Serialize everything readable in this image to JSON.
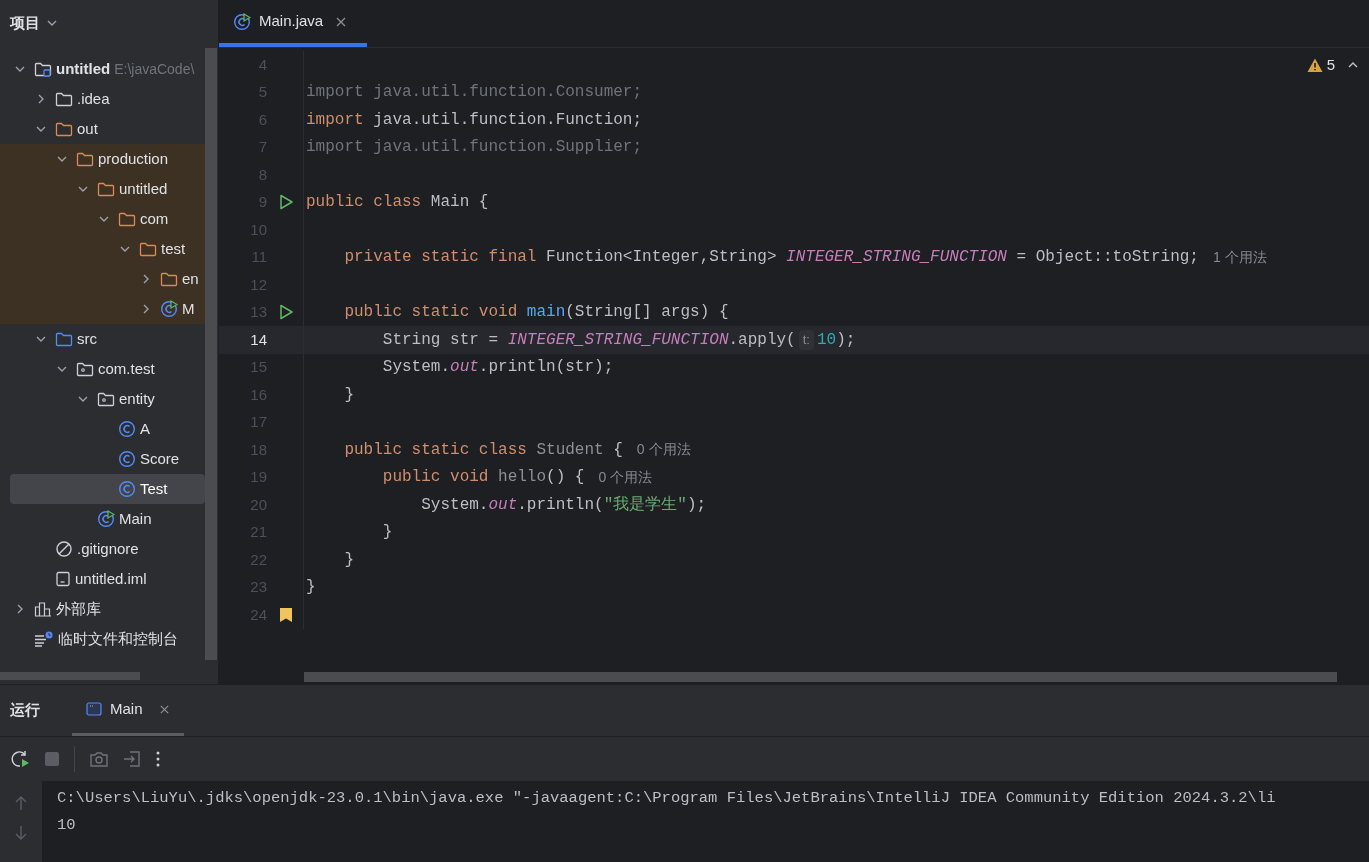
{
  "sidebar": {
    "title": "项目",
    "tree": [
      {
        "label": "untitled",
        "path": "E:\\javaCode\\",
        "kind": "module",
        "expanded": true,
        "selected": false,
        "children": [
          {
            "label": ".idea",
            "kind": "folder",
            "expanded": false,
            "selected": false
          },
          {
            "label": "out",
            "kind": "folder_excluded",
            "expanded": true,
            "selected": false,
            "children": [
              {
                "label": "production",
                "kind": "folder_excluded",
                "expanded": true,
                "selected": false,
                "children": [
                  {
                    "label": "untitled",
                    "kind": "folder_excluded",
                    "expanded": true,
                    "selected": false,
                    "children": [
                      {
                        "label": "com",
                        "kind": "folder_excluded",
                        "expanded": true,
                        "selected": false,
                        "children": [
                          {
                            "label": "test",
                            "kind": "folder_excluded",
                            "expanded": true,
                            "selected": false,
                            "children": [
                              {
                                "label": "en",
                                "kind": "folder_excluded",
                                "expanded": false,
                                "selected": false
                              },
                              {
                                "label": "M",
                                "kind": "class_main",
                                "expanded": false,
                                "selected": false
                              }
                            ]
                          }
                        ]
                      }
                    ]
                  }
                ]
              }
            ]
          },
          {
            "label": "src",
            "kind": "folder_source",
            "expanded": true,
            "selected": false,
            "children": [
              {
                "label": "com.test",
                "kind": "package",
                "expanded": true,
                "selected": false,
                "children": [
                  {
                    "label": "entity",
                    "kind": "package",
                    "expanded": true,
                    "selected": false,
                    "children": [
                      {
                        "label": "A",
                        "kind": "class",
                        "selected": false
                      },
                      {
                        "label": "Score",
                        "kind": "class",
                        "selected": false
                      },
                      {
                        "label": "Test",
                        "kind": "class",
                        "selected": true
                      }
                    ]
                  },
                  {
                    "label": "Main",
                    "kind": "class_main",
                    "selected": false
                  }
                ]
              }
            ]
          },
          {
            "label": ".gitignore",
            "kind": "ignore",
            "selected": false
          },
          {
            "label": "untitled.iml",
            "kind": "iml",
            "selected": false
          }
        ]
      },
      {
        "label": "外部库",
        "kind": "libraries",
        "expanded": false,
        "selected": false
      },
      {
        "label": "临时文件和控制台",
        "kind": "scratches",
        "selected": false
      }
    ]
  },
  "editor": {
    "tabs": [
      {
        "label": "Main.java",
        "selected": true
      }
    ],
    "warnings": "5",
    "lines": [
      {
        "number": "4",
        "current": false,
        "kind": "plain"
      },
      {
        "number": "5",
        "current": false,
        "kind": "plain",
        "segments": [
          {
            "kind": "code",
            "tokens": [
              {
                "kind": "unused",
                "text": "import java.util.function.Consumer;"
              }
            ]
          }
        ]
      },
      {
        "number": "6",
        "current": false,
        "kind": "plain",
        "segments": [
          {
            "kind": "code",
            "tokens": [
              {
                "kind": "keyword",
                "text": "import "
              },
              {
                "kind": "plain",
                "text": "java.util.function.Function;"
              }
            ]
          }
        ]
      },
      {
        "number": "7",
        "current": false,
        "kind": "plain",
        "segments": [
          {
            "kind": "code",
            "tokens": [
              {
                "kind": "unused",
                "text": "import java.util.function.Supplier;"
              }
            ]
          }
        ]
      },
      {
        "number": "8",
        "current": false,
        "kind": "plain"
      },
      {
        "number": "9",
        "current": false,
        "kind": "runnable",
        "segments": [
          {
            "kind": "code",
            "tokens": [
              {
                "kind": "keyword",
                "text": "public class "
              },
              {
                "kind": "plain",
                "text": "Main {"
              }
            ]
          }
        ]
      },
      {
        "number": "10",
        "current": false,
        "kind": "plain"
      },
      {
        "number": "11",
        "current": false,
        "kind": "plain",
        "segments": [
          {
            "kind": "code",
            "tokens": [
              {
                "kind": "keyword",
                "text": "    private static final "
              },
              {
                "kind": "plain",
                "text": "Function<Integer,String> "
              },
              {
                "kind": "field",
                "text": "INTEGER_STRING_FUNCTION"
              },
              {
                "kind": "plain",
                "text": " = Object::toString;"
              }
            ]
          },
          {
            "kind": "hint",
            "text": "1 个用法"
          }
        ]
      },
      {
        "number": "12",
        "current": false,
        "kind": "plain"
      },
      {
        "number": "13",
        "current": false,
        "kind": "runnable",
        "segments": [
          {
            "kind": "code",
            "tokens": [
              {
                "kind": "keyword",
                "text": "    public static void "
              },
              {
                "kind": "method",
                "text": "main"
              },
              {
                "kind": "plain",
                "text": "(String[] args) {"
              }
            ]
          }
        ]
      },
      {
        "number": "14",
        "current": true,
        "kind": "plain",
        "segments": [
          {
            "kind": "code",
            "tokens": [
              {
                "kind": "plain",
                "text": "        String str = "
              },
              {
                "kind": "field",
                "text": "INTEGER_STRING_FUNCTION"
              },
              {
                "kind": "plain",
                "text": ".apply("
              }
            ]
          },
          {
            "kind": "param",
            "text": "t:"
          },
          {
            "kind": "code",
            "tokens": [
              {
                "kind": "number",
                "text": "10"
              },
              {
                "kind": "plain",
                "text": ");"
              }
            ]
          }
        ]
      },
      {
        "number": "15",
        "current": false,
        "kind": "plain",
        "segments": [
          {
            "kind": "code",
            "tokens": [
              {
                "kind": "plain",
                "text": "        System."
              },
              {
                "kind": "field",
                "text": "out"
              },
              {
                "kind": "plain",
                "text": ".println(str);"
              }
            ]
          }
        ]
      },
      {
        "number": "16",
        "current": false,
        "kind": "plain",
        "segments": [
          {
            "kind": "code",
            "tokens": [
              {
                "kind": "plain",
                "text": "    }"
              }
            ]
          }
        ]
      },
      {
        "number": "17",
        "current": false,
        "kind": "plain"
      },
      {
        "number": "18",
        "current": false,
        "kind": "plain",
        "segments": [
          {
            "kind": "code",
            "tokens": [
              {
                "kind": "keyword",
                "text": "    public static class "
              },
              {
                "kind": "unused_decl",
                "text": "Student"
              },
              {
                "kind": "plain",
                "text": " {"
              }
            ]
          },
          {
            "kind": "hint",
            "text": "0 个用法"
          }
        ]
      },
      {
        "number": "19",
        "current": false,
        "kind": "plain",
        "segments": [
          {
            "kind": "code",
            "tokens": [
              {
                "kind": "keyword",
                "text": "        public void "
              },
              {
                "kind": "unused_decl",
                "text": "hello"
              },
              {
                "kind": "plain",
                "text": "() {"
              }
            ]
          },
          {
            "kind": "hint",
            "text": "0 个用法"
          }
        ]
      },
      {
        "number": "20",
        "current": false,
        "kind": "plain",
        "segments": [
          {
            "kind": "code",
            "tokens": [
              {
                "kind": "plain",
                "text": "            System."
              },
              {
                "kind": "field",
                "text": "out"
              },
              {
                "kind": "plain",
                "text": ".println("
              },
              {
                "kind": "string",
                "text": "\"我是学生\""
              },
              {
                "kind": "plain",
                "text": ");"
              }
            ]
          }
        ]
      },
      {
        "number": "21",
        "current": false,
        "kind": "plain",
        "segments": [
          {
            "kind": "code",
            "tokens": [
              {
                "kind": "plain",
                "text": "        }"
              }
            ]
          }
        ]
      },
      {
        "number": "22",
        "current": false,
        "kind": "plain",
        "segments": [
          {
            "kind": "code",
            "tokens": [
              {
                "kind": "plain",
                "text": "    }"
              }
            ]
          }
        ]
      },
      {
        "number": "23",
        "current": false,
        "kind": "plain",
        "segments": [
          {
            "kind": "code",
            "tokens": [
              {
                "kind": "plain",
                "text": "}"
              }
            ]
          }
        ]
      },
      {
        "number": "24",
        "current": false,
        "kind": "bookmarked"
      }
    ]
  },
  "run_panel": {
    "title": "运行",
    "tabs": [
      {
        "label": "Main",
        "selected": true
      }
    ],
    "console": [
      "C:\\Users\\LiuYu\\.jdks\\openjdk-23.0.1\\bin\\java.exe \"-javaagent:C:\\Program Files\\JetBrains\\IntelliJ IDEA Community Edition 2024.3.2\\li",
      "10"
    ]
  }
}
